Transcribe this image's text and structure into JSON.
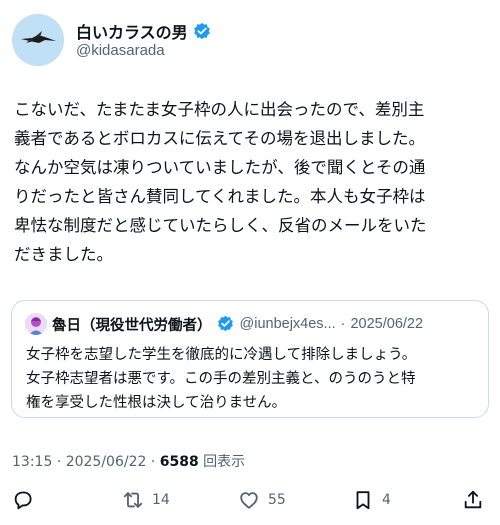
{
  "author": {
    "display_name": "白いカラスの男",
    "handle": "@kidasarada"
  },
  "tweet": {
    "lines": [
      "こないだ、たまたま女子枠の人に出会ったので、差別主",
      "義者であるとボロカスに伝えてその場を退出しました。",
      "なんか空気は凍りついていましたが、後で聞くとその通",
      "りだったと皆さん賛同してくれました。本人も女子枠は",
      "卑怯な制度だと感じていたらしく、反省のメールをいた",
      "だきました。"
    ]
  },
  "quote": {
    "display_name": "魯日（現役世代労働者）",
    "handle": "@iunbejx4es...",
    "separator": "·",
    "date": "2025/06/22",
    "lines": [
      "女子枠を志望した学生を徹底的に冷遇して排除しましょう。",
      "女子枠志望者は悪です。この手の差別主義と、のうのうと特",
      "権を享受した性根は決して治りません。"
    ]
  },
  "meta": {
    "time_date": "13:15 · 2025/06/22 · ",
    "views": "6588",
    "views_label": " 回表示"
  },
  "actions": {
    "reply_icon": "reply-icon",
    "repost_count": "14",
    "like_count": "55",
    "bookmark_count": "4",
    "share_icon": "share-icon"
  },
  "colors": {
    "verified_blue": "#1d9bf0",
    "secondary_text": "#536471",
    "border": "#cfd9de"
  }
}
